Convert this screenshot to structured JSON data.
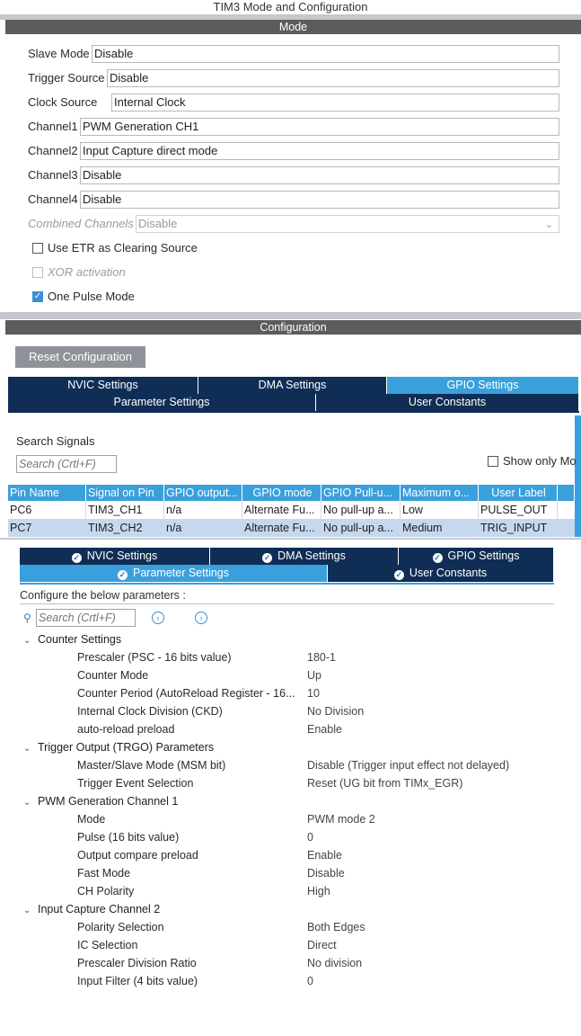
{
  "window_title": "TIM3 Mode and Configuration",
  "mode_section": {
    "header": "Mode",
    "rows": [
      {
        "label": "Slave Mode",
        "value": "Disable"
      },
      {
        "label": "Trigger Source",
        "value": "Disable"
      },
      {
        "label": "Clock Source",
        "value": "Internal Clock"
      },
      {
        "label": "Channel1",
        "value": "PWM Generation CH1"
      },
      {
        "label": "Channel2",
        "value": "Input Capture direct mode"
      },
      {
        "label": "Channel3",
        "value": "Disable"
      },
      {
        "label": "Channel4",
        "value": "Disable"
      },
      {
        "label": "Combined Channels",
        "value": "Disable"
      }
    ],
    "checkboxes": [
      {
        "label": "Use ETR as Clearing Source",
        "checked": false,
        "disabled": false
      },
      {
        "label": "XOR activation",
        "checked": false,
        "disabled": true
      },
      {
        "label": "One Pulse Mode",
        "checked": true,
        "disabled": false
      }
    ]
  },
  "config_section": {
    "header": "Configuration",
    "reset_button": "Reset Configuration",
    "tabs_row1": [
      "NVIC Settings",
      "DMA Settings",
      "GPIO Settings"
    ],
    "tabs_row2": [
      "Parameter Settings",
      "User Constants"
    ],
    "active_tab": "GPIO Settings",
    "search_label": "Search Signals",
    "search_placeholder": "Search (Crtl+F)",
    "show_only_label": "Show only Mo",
    "table": {
      "columns": [
        "Pin Name",
        "Signal on Pin",
        "GPIO output...",
        "GPIO mode",
        "GPIO Pull-u...",
        "Maximum o...",
        "User Label"
      ],
      "rows": [
        [
          "PC6",
          "TIM3_CH1",
          "n/a",
          "Alternate Fu...",
          "No pull-up a...",
          "Low",
          "PULSE_OUT"
        ],
        [
          "PC7",
          "TIM3_CH2",
          "n/a",
          "Alternate Fu...",
          "No pull-up a...",
          "Medium",
          "TRIG_INPUT"
        ]
      ]
    }
  },
  "param_panel": {
    "tabs_row1": [
      "NVIC Settings",
      "DMA Settings",
      "GPIO Settings"
    ],
    "tabs_row2": [
      "Parameter Settings",
      "User Constants"
    ],
    "active_tab": "Parameter Settings",
    "configure_text": "Configure the below parameters :",
    "search_placeholder": "Search (Crtl+F)",
    "groups": [
      {
        "name": "Counter Settings",
        "params": [
          {
            "k": "Prescaler (PSC - 16 bits value)",
            "v": "180-1"
          },
          {
            "k": "Counter Mode",
            "v": "Up"
          },
          {
            "k": "Counter Period (AutoReload Register - 16...",
            "v": "10"
          },
          {
            "k": "Internal Clock Division (CKD)",
            "v": "No Division"
          },
          {
            "k": "auto-reload preload",
            "v": "Enable"
          }
        ]
      },
      {
        "name": "Trigger Output (TRGO) Parameters",
        "params": [
          {
            "k": "Master/Slave Mode (MSM bit)",
            "v": "Disable (Trigger input effect not delayed)"
          },
          {
            "k": "Trigger Event Selection",
            "v": "Reset (UG bit from TIMx_EGR)"
          }
        ]
      },
      {
        "name": "PWM Generation Channel 1",
        "params": [
          {
            "k": "Mode",
            "v": "PWM mode 2"
          },
          {
            "k": "Pulse (16 bits value)",
            "v": "0"
          },
          {
            "k": "Output compare preload",
            "v": "Enable"
          },
          {
            "k": "Fast Mode",
            "v": "Disable"
          },
          {
            "k": "CH Polarity",
            "v": "High"
          }
        ]
      },
      {
        "name": "Input Capture Channel 2",
        "params": [
          {
            "k": "Polarity Selection",
            "v": "Both Edges"
          },
          {
            "k": "IC Selection",
            "v": "Direct"
          },
          {
            "k": "Prescaler Division Ratio",
            "v": "No division"
          },
          {
            "k": "Input Filter (4 bits value)",
            "v": "0"
          }
        ]
      }
    ]
  }
}
